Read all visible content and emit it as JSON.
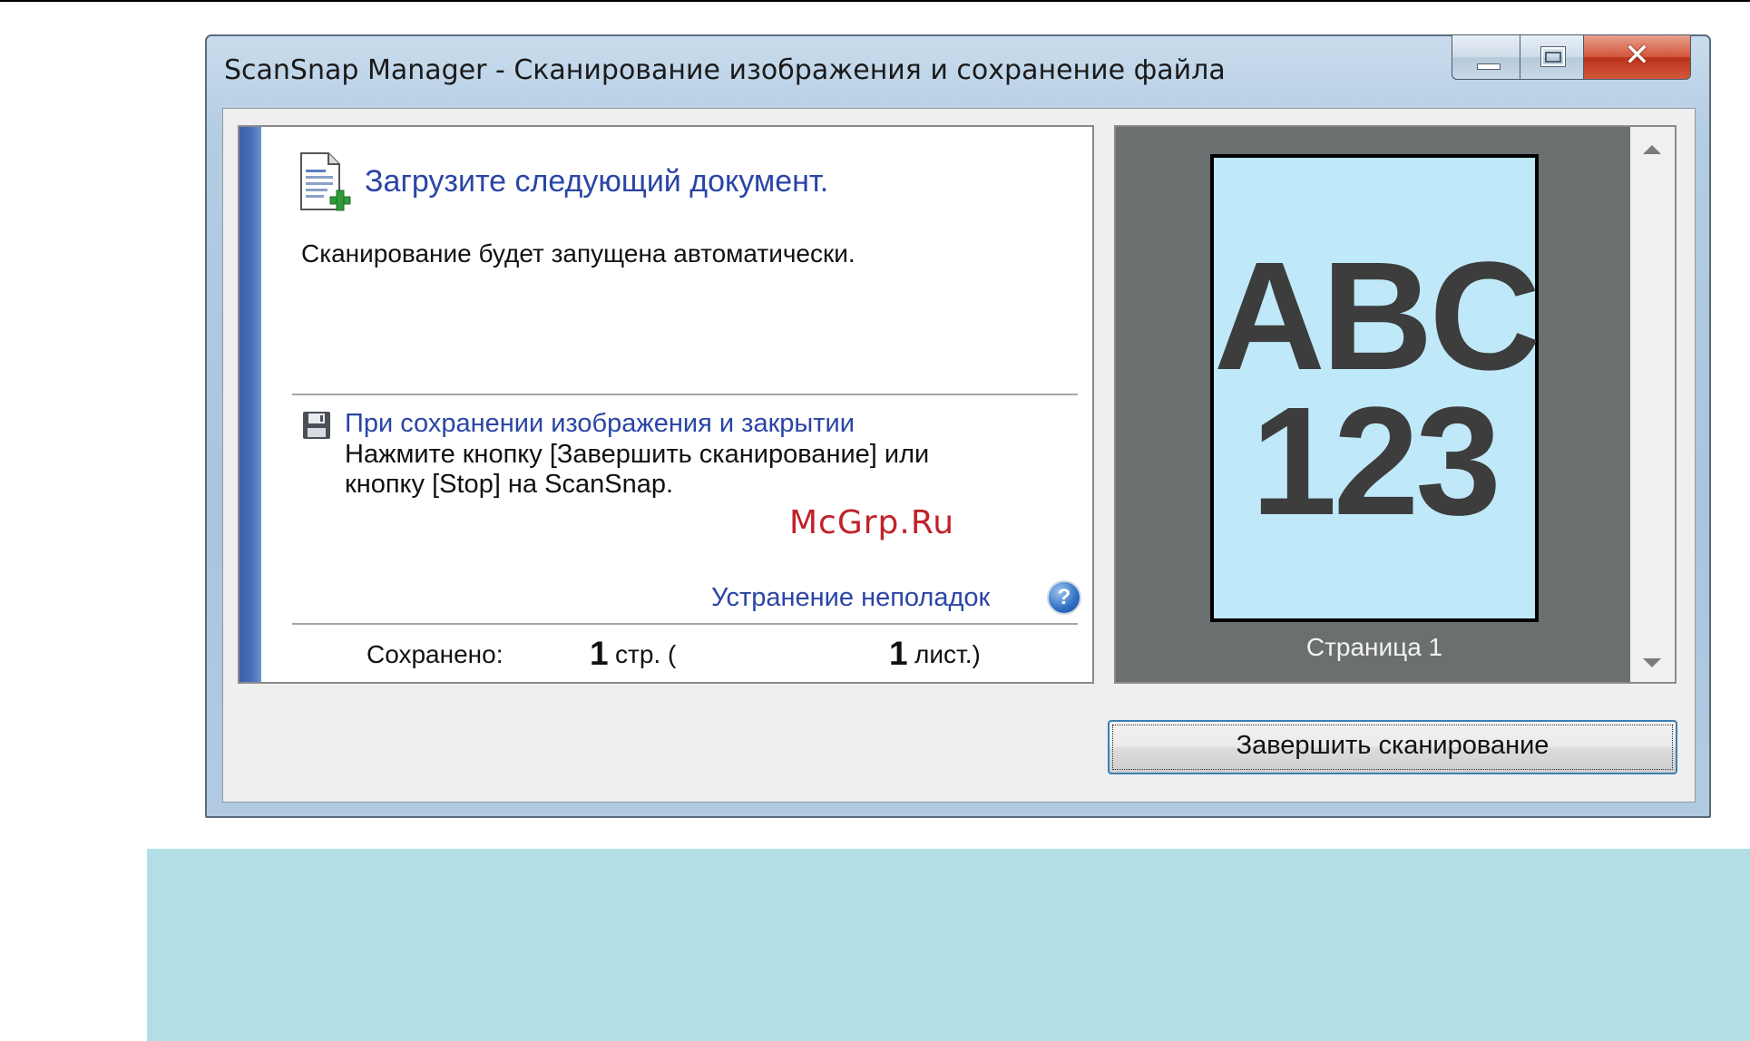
{
  "window": {
    "title": "ScanSnap Manager - Сканирование изображения и сохранение файла",
    "minimize_icon": "minimize-icon",
    "maximize_icon": "restore-icon",
    "close_glyph": "✕"
  },
  "main": {
    "heading": "Загрузите следующий документ.",
    "auto_scan_text": "Сканирование будет запущена автоматически.",
    "save_section": {
      "title": "При сохранении изображения и закрытии",
      "line1": "Нажмите кнопку [Завершить сканирование] или",
      "line2": "кнопку [Stop] на ScanSnap."
    },
    "troubleshooting_link": "Устранение неполадок",
    "help_glyph": "?",
    "status": {
      "saved_label": "Сохранено:",
      "pages_count": "1",
      "pages_unit": "стр. (",
      "sheets_count": "1",
      "sheets_unit": "лист.)"
    }
  },
  "preview": {
    "thumbnail_line1": "ABC",
    "thumbnail_line2": "123",
    "page_caption": "Страница 1"
  },
  "footer": {
    "finish_button": "Завершить сканирование"
  },
  "watermark": "McGrp.Ru",
  "colors": {
    "accent_text": "#2a45a6",
    "preview_background": "#6c6f70",
    "thumbnail_background": "#bfe9f8",
    "band": "#b2dfe5",
    "watermark": "#c0222a"
  }
}
